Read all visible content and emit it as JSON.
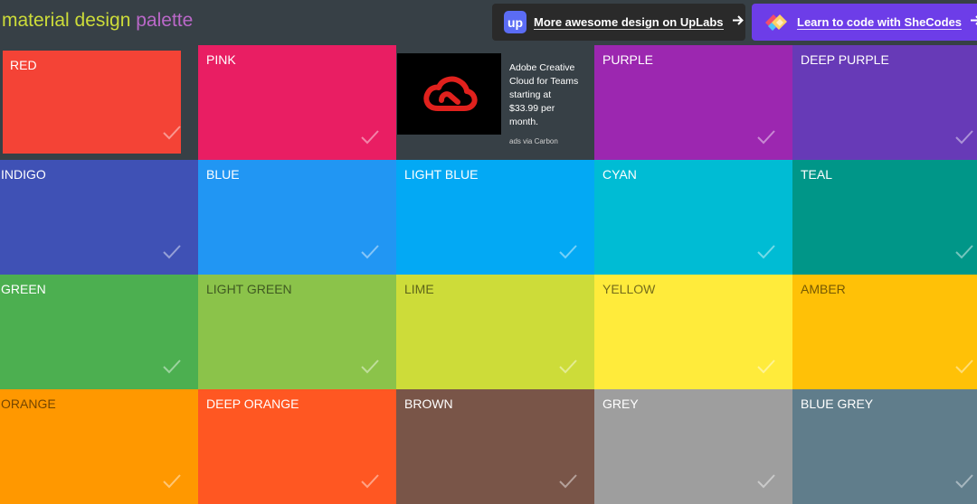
{
  "header": {
    "logo_word1": "material design",
    "logo_word2": "palette",
    "uplabs_icon": "up",
    "uplabs_label": "More awesome design on UpLabs",
    "shecodes_label": "Learn to code with SheCodes",
    "arrow_icon": "right-arrow-icon"
  },
  "ad": {
    "text": "Adobe Creative Cloud for Teams starting at $33.99 per month.",
    "via": "ads via Carbon",
    "image_icon": "adobe-creative-cloud-logo"
  },
  "colors": [
    {
      "name": "RED",
      "hex": "#f44336",
      "selected": true
    },
    {
      "name": "PINK",
      "hex": "#e91e63"
    },
    {
      "name": "PURPLE",
      "hex": "#9c27b0"
    },
    {
      "name": "DEEP PURPLE",
      "hex": "#673ab7"
    },
    {
      "name": "INDIGO",
      "hex": "#3f51b5"
    },
    {
      "name": "BLUE",
      "hex": "#2196f3"
    },
    {
      "name": "LIGHT BLUE",
      "hex": "#03a9f4"
    },
    {
      "name": "CYAN",
      "hex": "#00bcd4"
    },
    {
      "name": "TEAL",
      "hex": "#009688"
    },
    {
      "name": "GREEN",
      "hex": "#4caf50"
    },
    {
      "name": "LIGHT GREEN",
      "hex": "#8bc34a",
      "dark_text": true
    },
    {
      "name": "LIME",
      "hex": "#cddc39",
      "dark_text": true
    },
    {
      "name": "YELLOW",
      "hex": "#ffeb3b",
      "dark_text": true
    },
    {
      "name": "AMBER",
      "hex": "#ffc107",
      "dark_text": true
    },
    {
      "name": "ORANGE",
      "hex": "#ff9800",
      "dark_text": true
    },
    {
      "name": "DEEP ORANGE",
      "hex": "#ff5722"
    },
    {
      "name": "BROWN",
      "hex": "#795548"
    },
    {
      "name": "GREY",
      "hex": "#9e9e9e"
    },
    {
      "name": "BLUE GREY",
      "hex": "#607d8b"
    }
  ]
}
